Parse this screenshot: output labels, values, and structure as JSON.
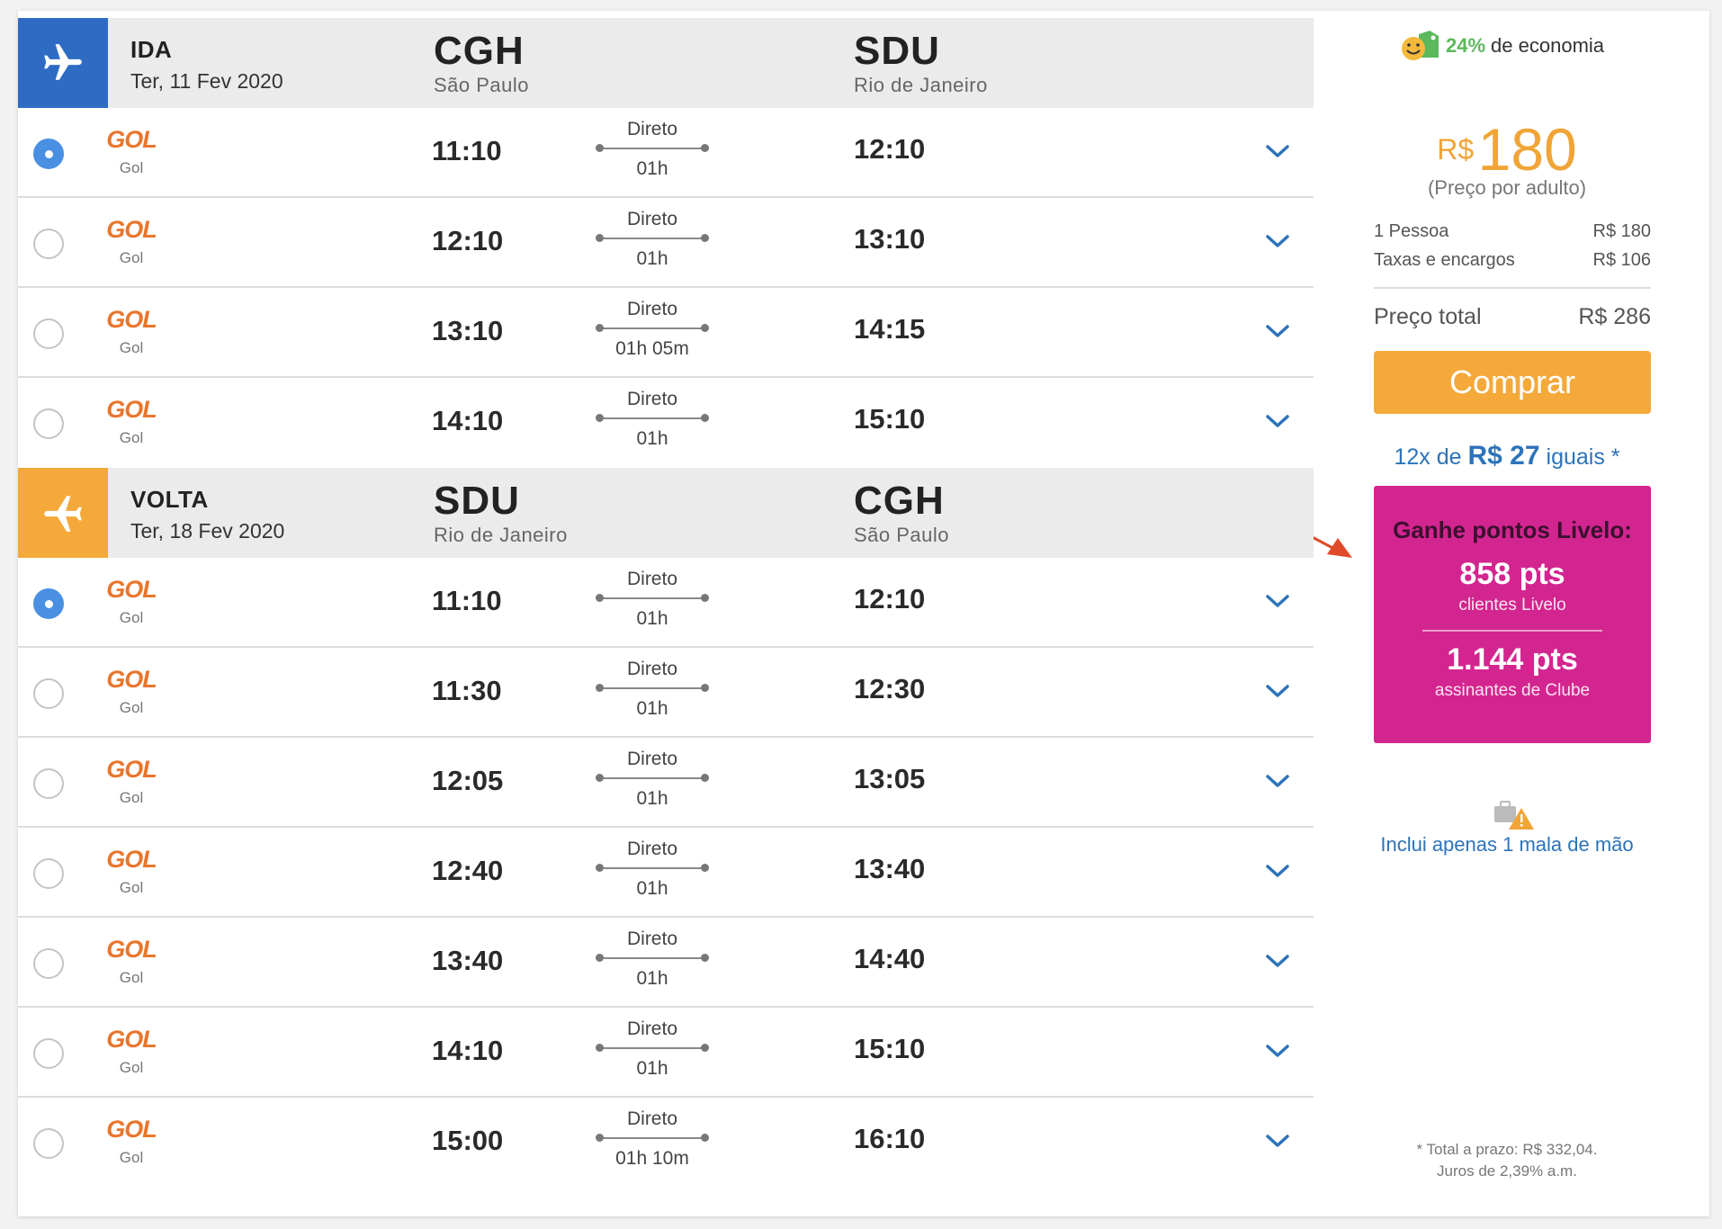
{
  "outbound": {
    "label": "IDA",
    "date": "Ter, 11 Fev 2020",
    "from_code": "CGH",
    "from_city": "São Paulo",
    "to_code": "SDU",
    "to_city": "Rio de Janeiro",
    "icon_color": "#2e6cc4",
    "flights": [
      {
        "selected": true,
        "airline_logo": "GOL",
        "airline": "Gol",
        "dep": "11:10",
        "type": "Direto",
        "duration": "01h",
        "arr": "12:10"
      },
      {
        "selected": false,
        "airline_logo": "GOL",
        "airline": "Gol",
        "dep": "12:10",
        "type": "Direto",
        "duration": "01h",
        "arr": "13:10"
      },
      {
        "selected": false,
        "airline_logo": "GOL",
        "airline": "Gol",
        "dep": "13:10",
        "type": "Direto",
        "duration": "01h 05m",
        "arr": "14:15"
      },
      {
        "selected": false,
        "airline_logo": "GOL",
        "airline": "Gol",
        "dep": "14:10",
        "type": "Direto",
        "duration": "01h",
        "arr": "15:10"
      }
    ]
  },
  "return": {
    "label": "VOLTA",
    "date": "Ter, 18 Fev 2020",
    "from_code": "SDU",
    "from_city": "Rio de Janeiro",
    "to_code": "CGH",
    "to_city": "São Paulo",
    "icon_color": "#f4a93a",
    "flights": [
      {
        "selected": true,
        "airline_logo": "GOL",
        "airline": "Gol",
        "dep": "11:10",
        "type": "Direto",
        "duration": "01h",
        "arr": "12:10"
      },
      {
        "selected": false,
        "airline_logo": "GOL",
        "airline": "Gol",
        "dep": "11:30",
        "type": "Direto",
        "duration": "01h",
        "arr": "12:30"
      },
      {
        "selected": false,
        "airline_logo": "GOL",
        "airline": "Gol",
        "dep": "12:05",
        "type": "Direto",
        "duration": "01h",
        "arr": "13:05"
      },
      {
        "selected": false,
        "airline_logo": "GOL",
        "airline": "Gol",
        "dep": "12:40",
        "type": "Direto",
        "duration": "01h",
        "arr": "13:40"
      },
      {
        "selected": false,
        "airline_logo": "GOL",
        "airline": "Gol",
        "dep": "13:40",
        "type": "Direto",
        "duration": "01h",
        "arr": "14:40"
      },
      {
        "selected": false,
        "airline_logo": "GOL",
        "airline": "Gol",
        "dep": "14:10",
        "type": "Direto",
        "duration": "01h",
        "arr": "15:10"
      },
      {
        "selected": false,
        "airline_logo": "GOL",
        "airline": "Gol",
        "dep": "15:00",
        "type": "Direto",
        "duration": "01h 10m",
        "arr": "16:10"
      }
    ]
  },
  "summary": {
    "economy_pct": "24%",
    "economy_text": "de economia",
    "currency": "R$",
    "price": "180",
    "price_note": "(Preço por adulto)",
    "items": [
      {
        "label": "1 Pessoa",
        "value": "R$ 180"
      },
      {
        "label": "Taxas e encargos",
        "value": "R$ 106"
      }
    ],
    "total_label": "Preço total",
    "total_value": "R$ 286",
    "buy_label": "Comprar",
    "install_prefix": "12x de",
    "install_amount": "R$ 27",
    "install_suffix": "iguais *",
    "livelo_title": "Ganhe pontos Livelo:",
    "livelo_pts1": "858 pts",
    "livelo_sub1": "clientes Livelo",
    "livelo_pts2": "1.144 pts",
    "livelo_sub2": "assinantes de Clube",
    "baggage_text": "Inclui apenas 1 mala de mão",
    "footnote_1": "* Total a prazo: R$ 332,04.",
    "footnote_2": "Juros de 2,39% a.m."
  },
  "colors": {
    "accent_blue": "#2e6cc4",
    "accent_orange": "#f4a93a",
    "livelo_pink": "#d3258f",
    "link_blue": "#2d73b9",
    "gol_orange": "#e8762d"
  }
}
